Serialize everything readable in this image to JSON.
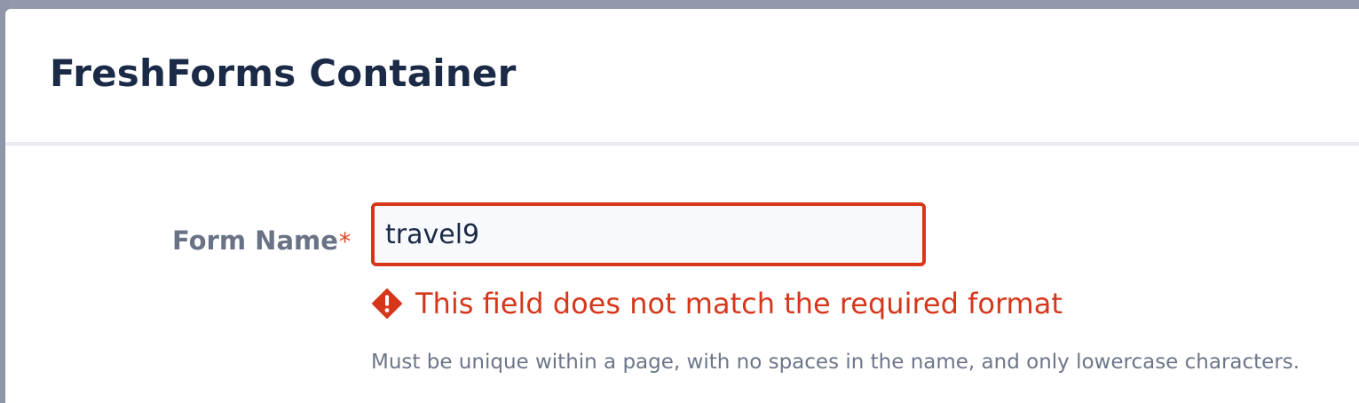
{
  "modal": {
    "title": "FreshForms Container"
  },
  "form_name_field": {
    "label": "Form Name",
    "required_marker": "*",
    "value": "travel9",
    "error_message": "This field does not match the required format",
    "error_icon": "warning-diamond-icon",
    "help_text": "Must be unique within a page, with no spaces in the name, and only lowercase characters."
  },
  "colors": {
    "title": "#1b2a47",
    "label": "#6a7385",
    "error": "#d6371b",
    "help": "#6d7689",
    "backdrop": "#919aad",
    "input_background": "#f8f9fc"
  }
}
